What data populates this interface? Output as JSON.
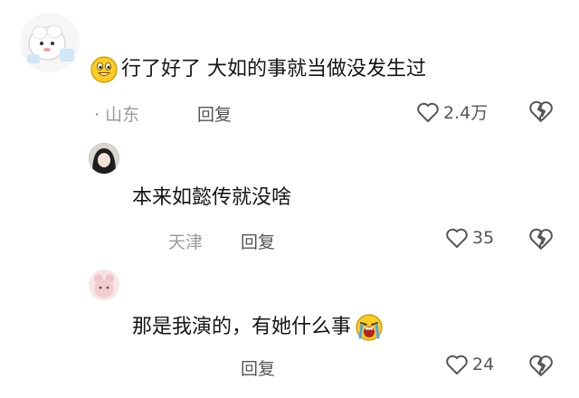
{
  "comments": [
    {
      "text": "行了好了 大如的事就当做没发生过",
      "location_prefix": "· ",
      "location": "山东",
      "reply_label": "回复",
      "likes": "2.4万",
      "emoji": "grinning-face-emoji",
      "avatar": "cartoon-sheep-avatar"
    },
    {
      "text": "本来如懿传就没啥",
      "location": "天津",
      "reply_label": "回复",
      "likes": "35",
      "avatar": "dark-portrait-avatar"
    },
    {
      "text": "那是我演的，有她什么事",
      "reply_label": "回复",
      "likes": "24",
      "emoji": "crying-face-emoji",
      "avatar": "pink-bear-avatar"
    }
  ],
  "colors": {
    "text": "#141414",
    "meta": "#9a9a9a",
    "action": "#555555",
    "emoji_yellow": "#ffcc22"
  },
  "icons": [
    "heart-outline-icon",
    "broken-heart-icon"
  ]
}
